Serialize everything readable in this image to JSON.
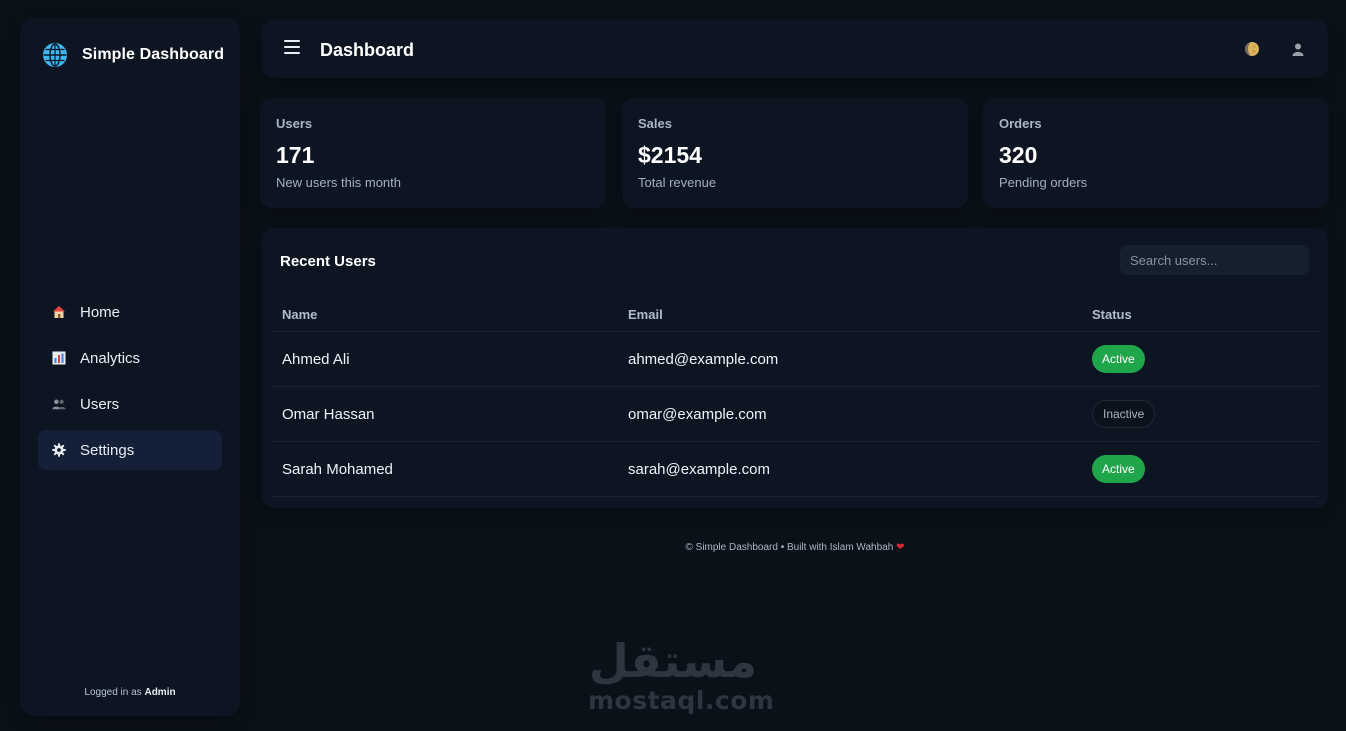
{
  "brand": {
    "title": "Simple Dashboard",
    "logo_icon": "globe-icon",
    "logo_color": "#3fb6f0"
  },
  "sidebar": {
    "items": [
      {
        "label": "Home",
        "icon": "house-icon",
        "active": false
      },
      {
        "label": "Analytics",
        "icon": "bar-chart-icon",
        "active": false
      },
      {
        "label": "Users",
        "icon": "users-icon",
        "active": false
      },
      {
        "label": "Settings",
        "icon": "gear-icon",
        "active": true
      }
    ],
    "footer_prefix": "Logged in as",
    "footer_user": "Admin"
  },
  "header": {
    "title": "Dashboard",
    "theme_icon": "moon-icon",
    "profile_icon": "user-icon"
  },
  "stats": [
    {
      "label": "Users",
      "value": "171",
      "sub": "New users this month"
    },
    {
      "label": "Sales",
      "value": "$2154",
      "sub": "Total revenue"
    },
    {
      "label": "Orders",
      "value": "320",
      "sub": "Pending orders"
    }
  ],
  "recent_users": {
    "title": "Recent Users",
    "search_placeholder": "Search users...",
    "columns": [
      "Name",
      "Email",
      "Status"
    ],
    "rows": [
      {
        "name": "Ahmed Ali",
        "email": "ahmed@example.com",
        "status": "Active"
      },
      {
        "name": "Omar Hassan",
        "email": "omar@example.com",
        "status": "Inactive"
      },
      {
        "name": "Sarah Mohamed",
        "email": "sarah@example.com",
        "status": "Active"
      }
    ]
  },
  "footer": {
    "text": "© Simple Dashboard • Built with Islam Wahbah",
    "heart": "❤"
  },
  "watermark": {
    "arabic": "مستقل",
    "latin": "mostaql.com"
  },
  "colors": {
    "active_badge": "#1fa54a",
    "accent": "#3fb6f0",
    "heart": "#e0252e",
    "background": "#0b1119",
    "card": "#0e1522"
  }
}
